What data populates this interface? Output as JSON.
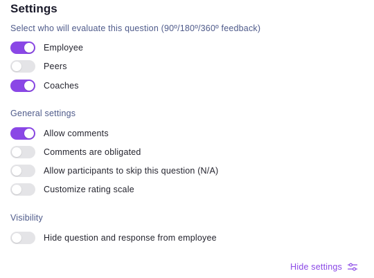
{
  "title": "Settings",
  "evaluators": {
    "heading": "Select who will evaluate this question (90º/180º/360º feedback)",
    "items": [
      {
        "label": "Employee",
        "on": true
      },
      {
        "label": "Peers",
        "on": false
      },
      {
        "label": "Coaches",
        "on": true
      }
    ]
  },
  "general": {
    "heading": "General settings",
    "items": [
      {
        "label": "Allow comments",
        "on": true
      },
      {
        "label": "Comments are obligated",
        "on": false
      },
      {
        "label": "Allow participants to skip this question (N/A)",
        "on": false
      },
      {
        "label": "Customize rating scale",
        "on": false
      }
    ]
  },
  "visibility": {
    "heading": "Visibility",
    "items": [
      {
        "label": "Hide question and response from employee",
        "on": false
      }
    ]
  },
  "footer": {
    "hide_settings_label": "Hide settings",
    "icon": "sliders-icon"
  },
  "colors": {
    "accent": "#8a47e6",
    "toggle_off": "#e4e4e7",
    "heading": "#4e5a8a"
  }
}
